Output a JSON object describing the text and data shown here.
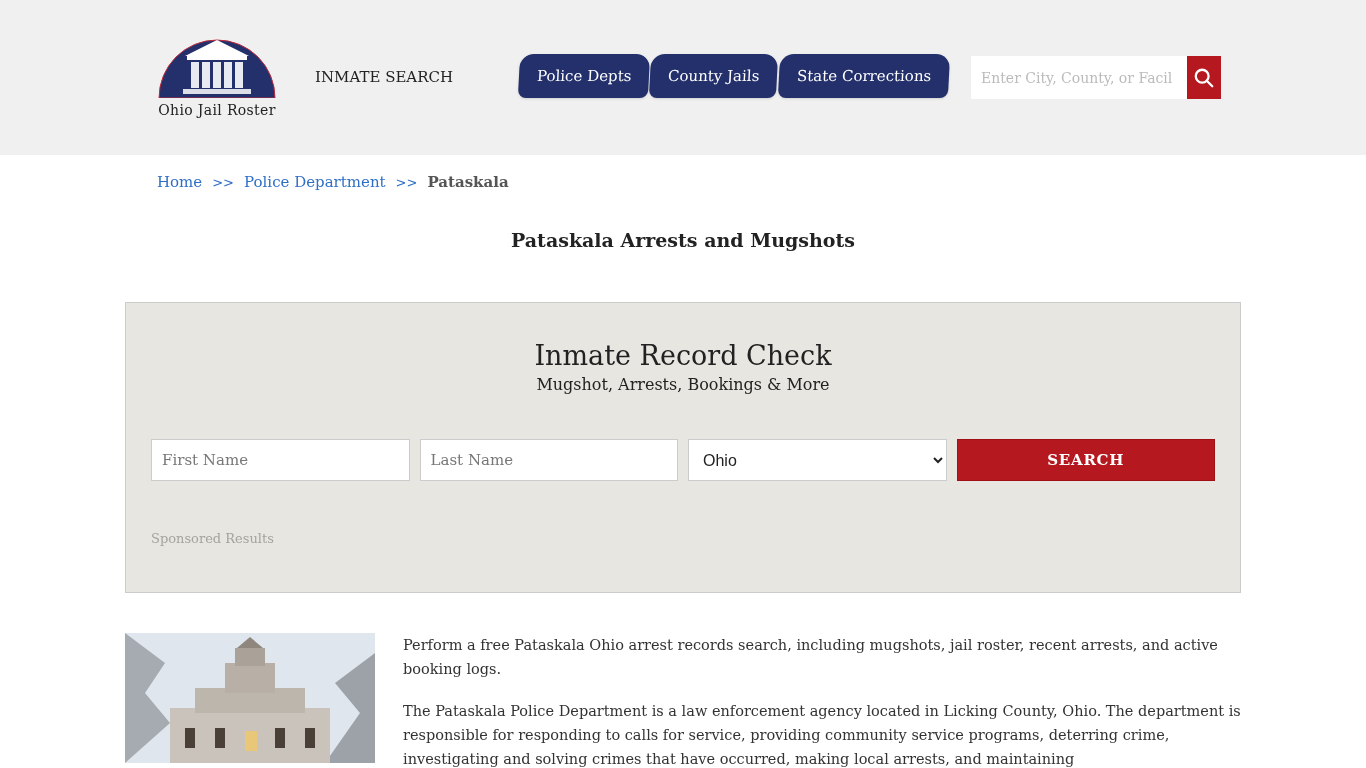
{
  "header": {
    "logo_text": "Ohio Jail Roster",
    "inmate_search": "INMATE SEARCH",
    "nav_tabs": [
      {
        "label": "Police Depts"
      },
      {
        "label": "County Jails"
      },
      {
        "label": "State Corrections"
      }
    ],
    "search": {
      "placeholder": "Enter City, County, or Facil"
    }
  },
  "breadcrumb": [
    {
      "label": "Home",
      "kind": "link"
    },
    {
      "label": ">>",
      "kind": "separator"
    },
    {
      "label": "Police Department",
      "kind": "link"
    },
    {
      "label": ">>",
      "kind": "separator"
    },
    {
      "label": "Pataskala",
      "kind": "current"
    }
  ],
  "page_title": "Pataskala Arrests and Mugshots",
  "record_check": {
    "title": "Inmate Record Check",
    "subtitle": "Mugshot, Arrests, Bookings & More",
    "first_name": {
      "placeholder": "First Name"
    },
    "last_name": {
      "placeholder": "Last Name"
    },
    "state": {
      "value": "Ohio"
    },
    "button": "SEARCH",
    "sponsored": "Sponsored Results"
  },
  "article": {
    "image": {
      "kind": "picture"
    },
    "paragraphs": [
      "Perform a free Pataskala Ohio arrest records search, including mugshots, jail roster, recent arrests, and active booking logs.",
      "The Pataskala Police Department is a law enforcement agency located in Licking County, Ohio. The department is responsible for responding to calls for service, providing community service programs, deterring crime, investigating and solving crimes that have occurred, making local arrests, and maintaining"
    ]
  }
}
